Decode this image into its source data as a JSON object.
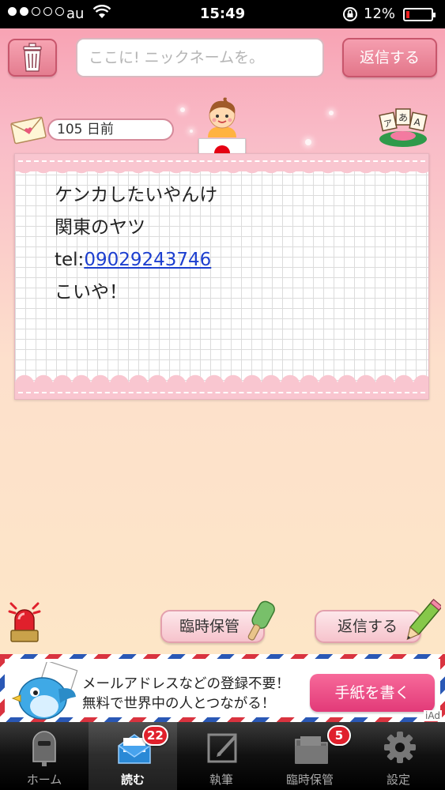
{
  "status_bar": {
    "carrier": "au",
    "time": "15:49",
    "battery": "12%",
    "battery_level": 0.12,
    "signal_bars": 2
  },
  "toolbar": {
    "nickname_placeholder": "ここに! ニックネームを。",
    "reply_label": "返信する"
  },
  "letter": {
    "date": "105 日前",
    "lines": [
      "ケンカしたいやんけ",
      "関東のヤツ"
    ],
    "tel_prefix": "tel:",
    "tel_number": "09029243746",
    "closing": "こいや！"
  },
  "actions": {
    "save_label": "臨時保管",
    "reply_label": "返信する"
  },
  "ad": {
    "line1": "メールアドレスなどの登録不要！",
    "line2": "無料で世界中の人とつながる！",
    "cta": "手紙を書く",
    "tag": "iAd"
  },
  "tabs": [
    {
      "label": "ホーム",
      "icon": "mailbox-icon"
    },
    {
      "label": "読む",
      "icon": "open-envelope-icon",
      "badge": "22"
    },
    {
      "label": "執筆",
      "icon": "write-icon"
    },
    {
      "label": "臨時保管",
      "icon": "folder-icon",
      "badge": "5"
    },
    {
      "label": "設定",
      "icon": "gear-icon"
    }
  ],
  "colors": {
    "header_pink": "#f8a3b4",
    "button_pink": "#e27488",
    "link_blue": "#1d3fcf",
    "badge_red": "#e0202c",
    "flag_red": "#e60012"
  }
}
